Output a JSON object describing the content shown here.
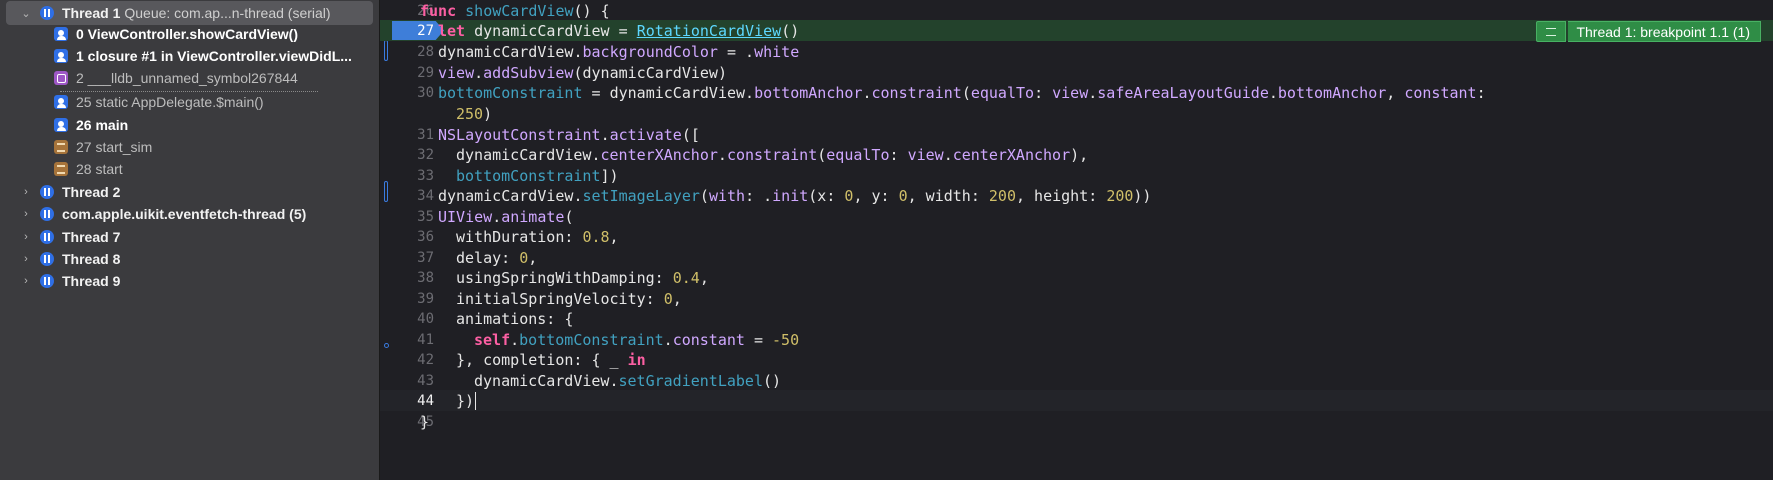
{
  "navigator": {
    "thread1": {
      "label": "Thread 1",
      "queue": "Queue: com.ap...n-thread (serial)",
      "frames": [
        {
          "text": "0 ViewController.showCardView()",
          "kind": "user",
          "style": "bold"
        },
        {
          "text": "1 closure #1 in ViewController.viewDidL...",
          "kind": "user",
          "style": "bold"
        },
        {
          "text": "2 ___lldb_unnamed_symbol267844",
          "kind": "sym",
          "style": "dim"
        },
        {
          "text": "25 static AppDelegate.$main()",
          "kind": "user",
          "style": "dim"
        },
        {
          "text": "26 main",
          "kind": "user",
          "style": "bold"
        },
        {
          "text": "27 start_sim",
          "kind": "sys",
          "style": "dim"
        },
        {
          "text": "28 start",
          "kind": "sys",
          "style": "dim"
        }
      ]
    },
    "threads": [
      {
        "label": "Thread 2"
      },
      {
        "label": "com.apple.uikit.eventfetch-thread (5)"
      },
      {
        "label": "Thread 7"
      },
      {
        "label": "Thread 8"
      },
      {
        "label": "Thread 9"
      }
    ]
  },
  "editor": {
    "breakpoint_annotation": "Thread 1: breakpoint 1.1 (1)",
    "line_numbers": [
      "26",
      "27",
      "28",
      "29",
      "30",
      "",
      "31",
      "32",
      "33",
      "34",
      "35",
      "36",
      "37",
      "38",
      "39",
      "40",
      "41",
      "42",
      "43",
      "44",
      "45"
    ],
    "lines": {
      "l26": [
        "func",
        " ",
        "showCardView",
        "() {"
      ],
      "l27": [
        "let",
        " dynamicCardView = ",
        "RotationCardView",
        "()"
      ],
      "l28": [
        "dynamicCardView.",
        "backgroundColor",
        " = .",
        "white"
      ],
      "l29": [
        "view",
        ".",
        "addSubview",
        "(dynamicCardView)"
      ],
      "l30": [
        "bottomConstraint",
        " = dynamicCardView.",
        "bottomAnchor",
        ".",
        "constraint",
        "(",
        "equalTo",
        ": ",
        "view",
        ".",
        "safeAreaLayoutGuide",
        ".",
        "bottomAnchor",
        ", ",
        "constant",
        ":"
      ],
      "l30b": [
        "250",
        ")"
      ],
      "l31": [
        "NSLayoutConstraint",
        ".",
        "activate",
        "(["
      ],
      "l32": [
        "dynamicCardView.",
        "centerXAnchor",
        ".",
        "constraint",
        "(",
        "equalTo",
        ": ",
        "view",
        ".",
        "centerXAnchor",
        "),"
      ],
      "l33": [
        "bottomConstraint",
        "])"
      ],
      "l34": [
        "dynamicCardView.",
        "setImageLayer",
        "(",
        "with",
        ": .",
        "init",
        "(x: ",
        "0",
        ", y: ",
        "0",
        ", width: ",
        "200",
        ", height: ",
        "200",
        "))"
      ],
      "l35": [
        "UIView",
        ".",
        "animate",
        "("
      ],
      "l36": [
        "withDuration: ",
        "0.8",
        ","
      ],
      "l37": [
        "delay: ",
        "0",
        ","
      ],
      "l38": [
        "usingSpringWithDamping: ",
        "0.4",
        ","
      ],
      "l39": [
        "initialSpringVelocity: ",
        "0",
        ","
      ],
      "l40": [
        "animations: {"
      ],
      "l41": [
        "self",
        ".",
        "bottomConstraint",
        ".",
        "constant",
        " = ",
        "-50"
      ],
      "l42": [
        "}, completion: { _ ",
        "in"
      ],
      "l43": [
        "dynamicCardView.",
        "setGradientLabel",
        "()"
      ],
      "l44": [
        "})"
      ],
      "l45": [
        "}"
      ]
    }
  },
  "colors": {
    "keyword": "#fc5fa3",
    "project_symbol": "#41a1c0",
    "number": "#d0bf69",
    "type_ref": "#5dd8ff",
    "breakpoint": "#3e7ed9",
    "annotation_green": "#2f8d46",
    "highlight_line": "#23422c"
  },
  "icons": {
    "thread": "thread-icon",
    "user_frame": "person-icon",
    "symbol_frame": "cube-icon",
    "system_frame": "library-icon",
    "disclosure_open": "chevron-down-icon",
    "disclosure_closed": "chevron-right-icon"
  }
}
